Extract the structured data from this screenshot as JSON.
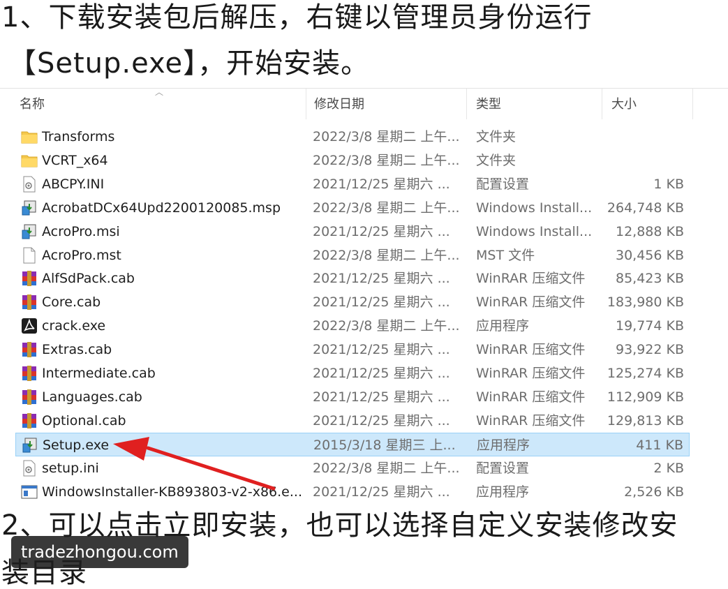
{
  "instructions": {
    "step1_line1": "1、下载安装包后解压，右键以管理员身份运行",
    "step1_line2": "【Setup.exe】，开始安装。",
    "step2_line1": "2、可以点击立即安装，也可以选择自定义安装修改安",
    "step2_line2": "装目录"
  },
  "explorer": {
    "columns": {
      "name": "名称",
      "date": "修改日期",
      "type": "类型",
      "size": "大小"
    },
    "files": [
      {
        "name": "Transforms",
        "date": "2022/3/8 星期二 上午...",
        "type": "文件夹",
        "size": "",
        "icon": "folder-icon"
      },
      {
        "name": "VCRT_x64",
        "date": "2022/3/8 星期二 上午...",
        "type": "文件夹",
        "size": "",
        "icon": "folder-icon"
      },
      {
        "name": "ABCPY.INI",
        "date": "2021/12/25 星期六 ...",
        "type": "配置设置",
        "size": "1 KB",
        "icon": "ini-file-icon"
      },
      {
        "name": "AcrobatDCx64Upd2200120085.msp",
        "date": "2022/3/8 星期二 上午...",
        "type": "Windows Install...",
        "size": "264,748 KB",
        "icon": "installer-icon"
      },
      {
        "name": "AcroPro.msi",
        "date": "2021/12/25 星期六 ...",
        "type": "Windows Install...",
        "size": "12,888 KB",
        "icon": "installer-icon"
      },
      {
        "name": "AcroPro.mst",
        "date": "2022/3/8 星期二 上午...",
        "type": "MST 文件",
        "size": "30,456 KB",
        "icon": "blank-file-icon"
      },
      {
        "name": "AlfSdPack.cab",
        "date": "2021/12/25 星期六 ...",
        "type": "WinRAR 压缩文件",
        "size": "85,423 KB",
        "icon": "winrar-icon"
      },
      {
        "name": "Core.cab",
        "date": "2021/12/25 星期六 ...",
        "type": "WinRAR 压缩文件",
        "size": "183,980 KB",
        "icon": "winrar-icon"
      },
      {
        "name": "crack.exe",
        "date": "2022/3/8 星期二 上午...",
        "type": "应用程序",
        "size": "19,774 KB",
        "icon": "acrobat-icon"
      },
      {
        "name": "Extras.cab",
        "date": "2021/12/25 星期六 ...",
        "type": "WinRAR 压缩文件",
        "size": "93,922 KB",
        "icon": "winrar-icon"
      },
      {
        "name": "Intermediate.cab",
        "date": "2021/12/25 星期六 ...",
        "type": "WinRAR 压缩文件",
        "size": "125,274 KB",
        "icon": "winrar-icon"
      },
      {
        "name": "Languages.cab",
        "date": "2021/12/25 星期六 ...",
        "type": "WinRAR 压缩文件",
        "size": "112,909 KB",
        "icon": "winrar-icon"
      },
      {
        "name": "Optional.cab",
        "date": "2021/12/25 星期六 ...",
        "type": "WinRAR 压缩文件",
        "size": "129,813 KB",
        "icon": "winrar-icon"
      },
      {
        "name": "Setup.exe",
        "date": "2015/3/18 星期三 上...",
        "type": "应用程序",
        "size": "411 KB",
        "icon": "installer-icon",
        "selected": true
      },
      {
        "name": "setup.ini",
        "date": "2022/3/8 星期二 上午...",
        "type": "配置设置",
        "size": "2 KB",
        "icon": "ini-file-icon"
      },
      {
        "name": "WindowsInstaller-KB893803-v2-x86.e...",
        "date": "2021/12/25 星期六 ...",
        "type": "应用程序",
        "size": "2,526 KB",
        "icon": "exe-window-icon"
      }
    ]
  },
  "annotation": {
    "arrow_color": "#e02020",
    "points_to": "Setup.exe"
  },
  "watermark": {
    "text": "tradezhongou.com"
  }
}
